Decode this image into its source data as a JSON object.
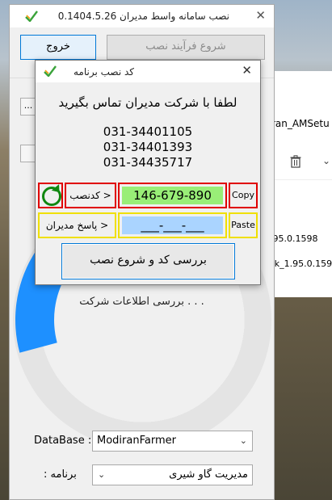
{
  "background_window": {
    "breadcrumb": "diran_AMSetu",
    "files": [
      "1.95.0.1598",
      "ack_1.95.0.1598"
    ]
  },
  "main_window": {
    "title": "نصب سامانه واسط مدیران 0.1404.5.26",
    "exit_label": "خروج",
    "start_label": "شروع فرآیند نصب",
    "small_button_label": "...",
    "status_text": ". . . بررسی اطلاعات شرکت",
    "progress_value": 0.2,
    "database_label": "DataBase :",
    "database_value": "ModiranFarmer",
    "program_label": "برنامه :",
    "program_value": "مدیریت گاو شیری"
  },
  "dialog": {
    "title": "کد نصب برنامه",
    "message": "لطفا با شرکت مدیران تماس بگیرید",
    "phones": [
      "031-34401105",
      "031-34401393",
      "031-34435717"
    ],
    "install_code_label": "< کدنصب",
    "install_code_value": "146-679-890",
    "copy_label": "Copy",
    "answer_label": "< پاسخ مدیران",
    "answer_value": "___-___-___",
    "paste_label": "Paste",
    "verify_label": "بررسی کد و شروع نصب"
  },
  "colors": {
    "code_bg": "#99ee77",
    "answer_bg": "#aad4ff",
    "code_border": "#e00000",
    "answer_border": "#f0e000",
    "accent": "#0078d7",
    "progress": "#1e90ff"
  },
  "icons": [
    "app-logo-icon",
    "close-icon",
    "refresh-icon",
    "trash-icon",
    "chevron-down-icon"
  ]
}
